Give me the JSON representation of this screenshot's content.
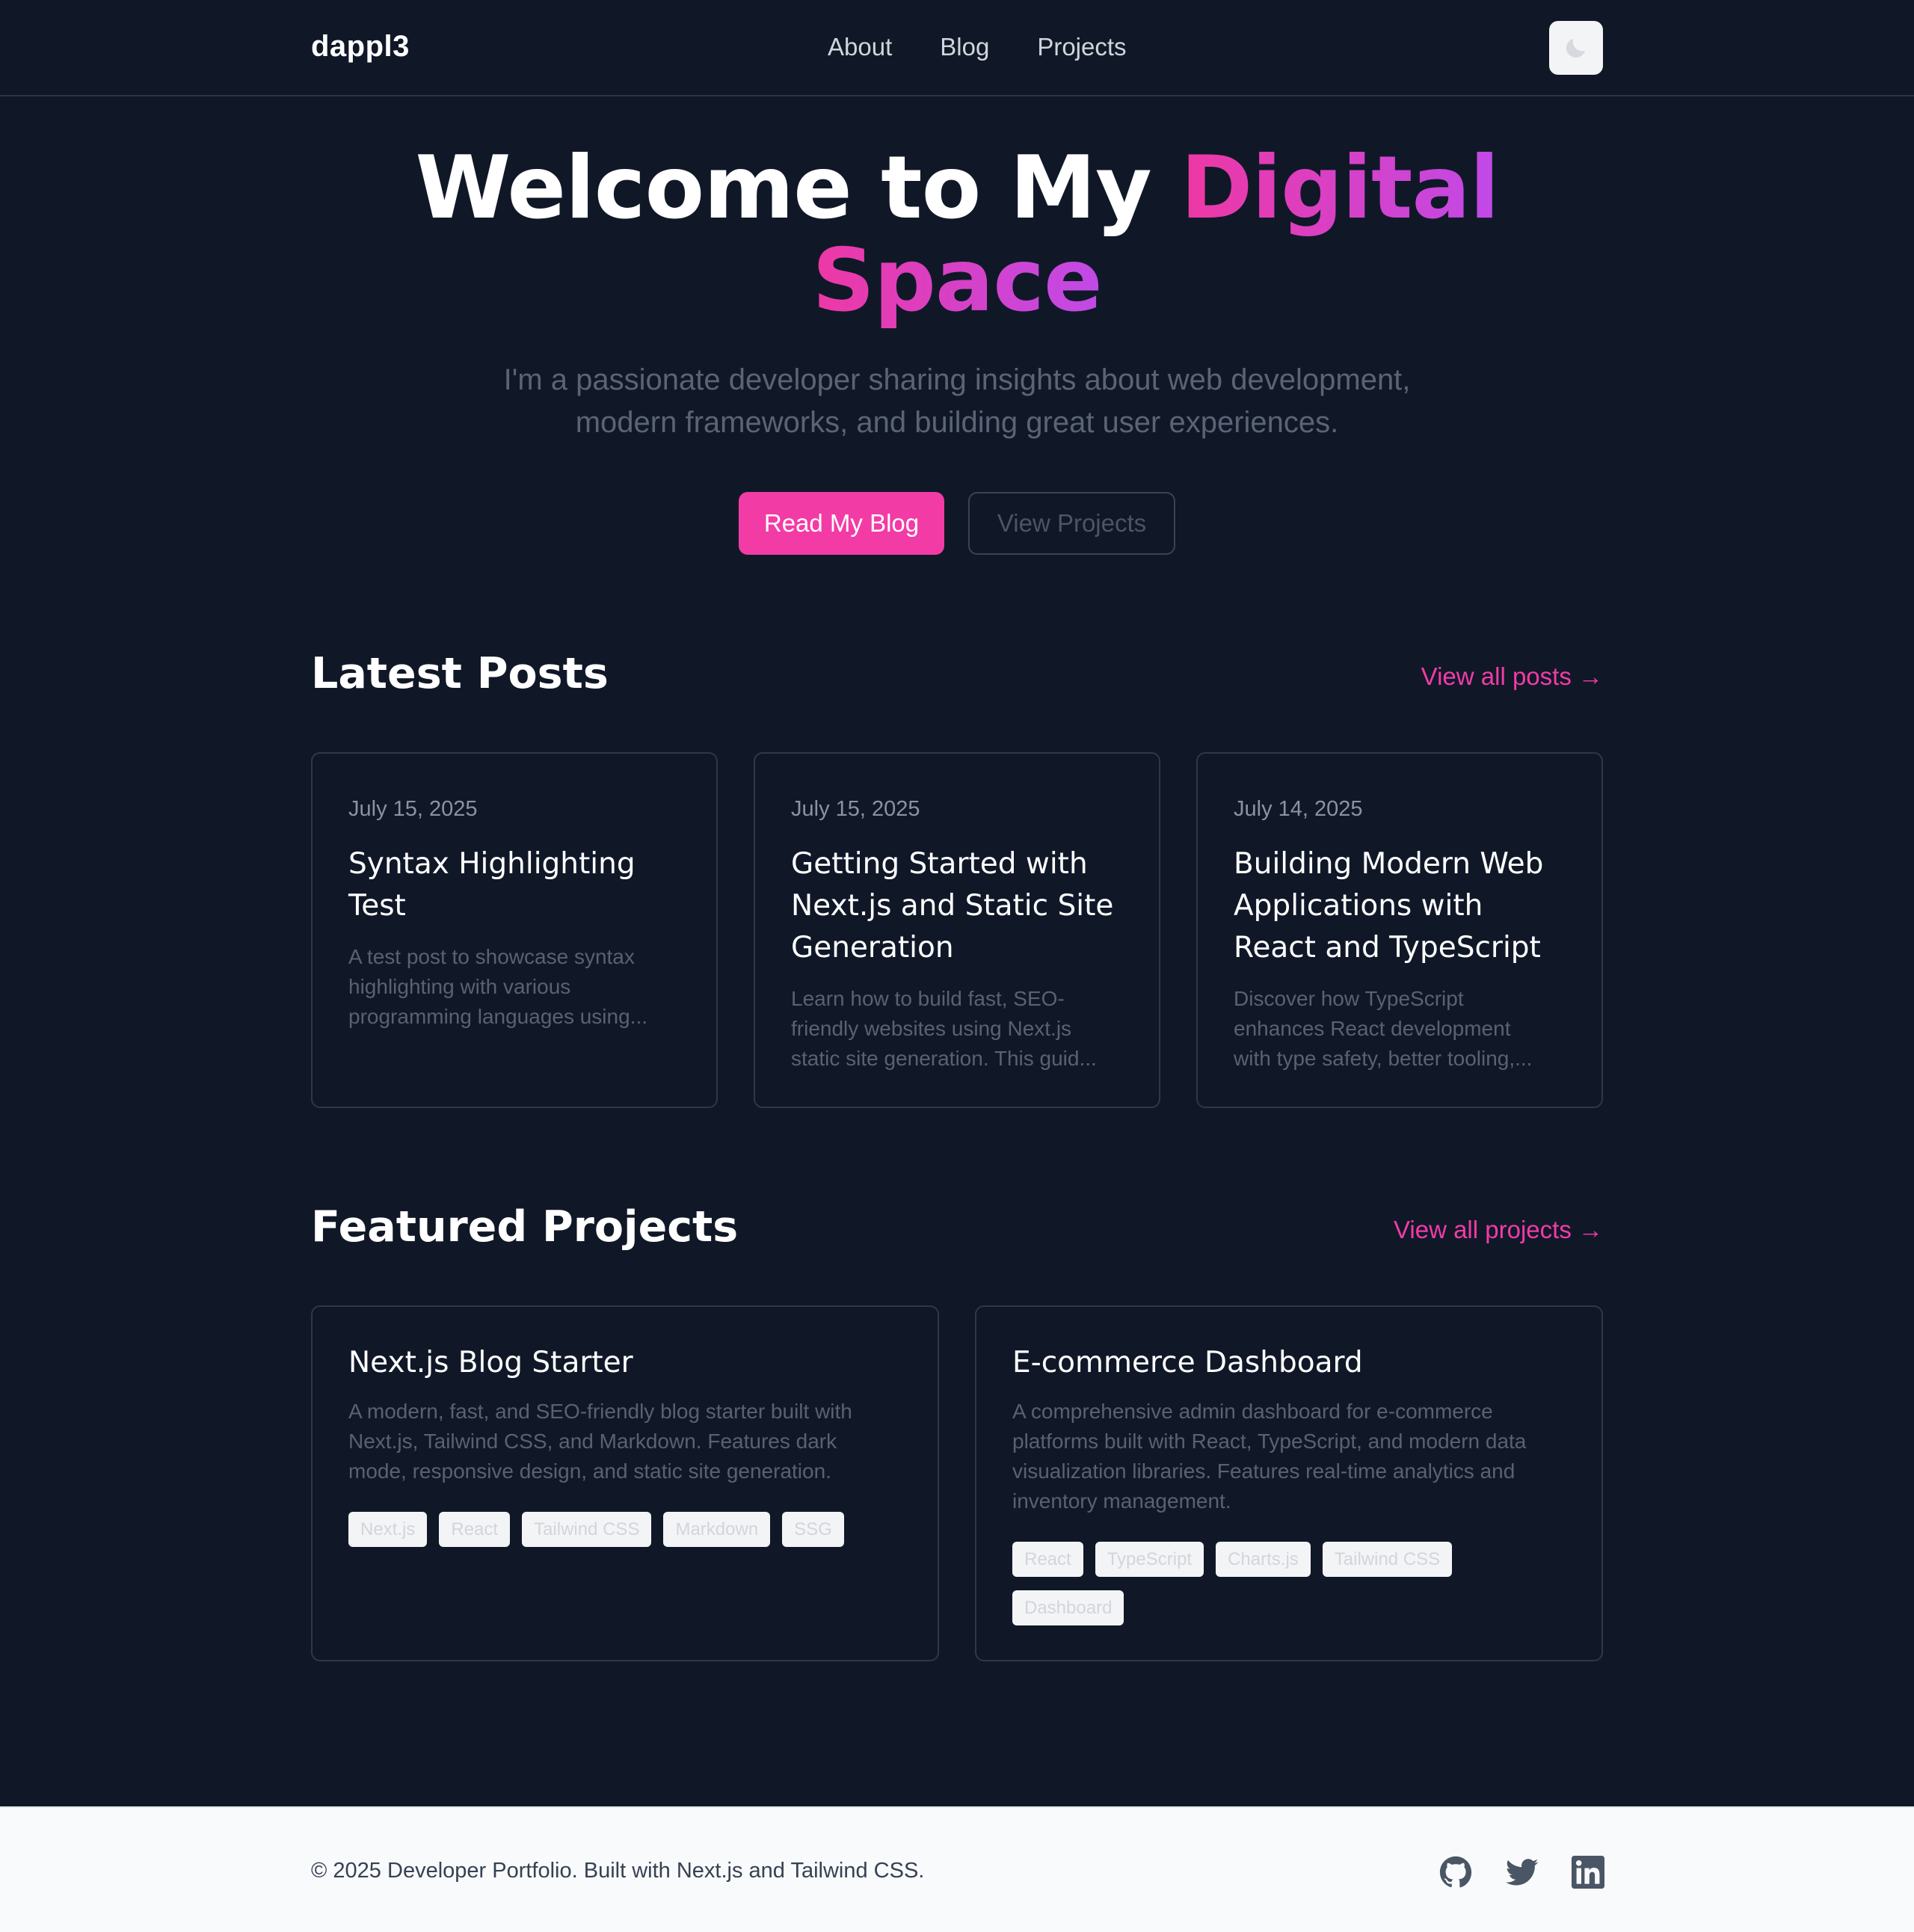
{
  "header": {
    "logo": "dappl3",
    "nav": [
      "About",
      "Blog",
      "Projects"
    ]
  },
  "hero": {
    "title_plain": "Welcome to My ",
    "title_accent_1": "Digital",
    "title_accent_2": "Space",
    "subtitle_line1": "I'm a passionate developer sharing insights about web development,",
    "subtitle_line2": "modern frameworks, and building great user experiences.",
    "primary_button": "Read My Blog",
    "secondary_button": "View Projects"
  },
  "posts_section": {
    "title": "Latest Posts",
    "view_all": "View all posts →",
    "posts": [
      {
        "date": "July 15, 2025",
        "title_lines": [
          "Syntax Highlighting",
          "Test"
        ],
        "desc_lines": [
          "A test post to showcase syntax",
          "highlighting with various",
          "programming languages using..."
        ]
      },
      {
        "date": "July 15, 2025",
        "title_lines": [
          "Getting Started with",
          "Next.js and Static Site",
          "Generation"
        ],
        "desc_lines": [
          "Learn how to build fast, SEO-",
          "friendly websites using Next.js",
          "static site generation. This guid..."
        ]
      },
      {
        "date": "July 14, 2025",
        "title_lines": [
          "Building Modern Web",
          "Applications with",
          "React and TypeScript"
        ],
        "desc_lines": [
          "Discover how TypeScript",
          "enhances React development",
          "with type safety, better tooling,..."
        ]
      }
    ]
  },
  "projects_section": {
    "title": "Featured Projects",
    "view_all": "View all projects →",
    "projects": [
      {
        "title": "Next.js Blog Starter",
        "desc_lines": [
          "A modern, fast, and SEO-friendly blog starter built with",
          "Next.js, Tailwind CSS, and Markdown. Features dark",
          "mode, responsive design, and static site generation."
        ],
        "tags": [
          "Next.js",
          "React",
          "Tailwind CSS",
          "Markdown",
          "SSG"
        ]
      },
      {
        "title": "E-commerce Dashboard",
        "desc_lines": [
          "A comprehensive admin dashboard for e-commerce",
          "platforms built with React, TypeScript, and modern data",
          "visualization libraries. Features real-time analytics and",
          "inventory management."
        ],
        "tags": [
          "React",
          "TypeScript",
          "Charts.js",
          "Tailwind CSS",
          "Dashboard"
        ]
      }
    ]
  },
  "footer": {
    "copyright": "© 2025 Developer Portfolio. Built with Next.js and Tailwind CSS.",
    "social_icons": [
      "github-icon",
      "twitter-icon",
      "linkedin-icon"
    ]
  },
  "colors": {
    "background": "#101828",
    "accent_pink": "#f33ba6",
    "accent_purple": "#c04ae8",
    "footer_bg": "#f9fafb"
  }
}
